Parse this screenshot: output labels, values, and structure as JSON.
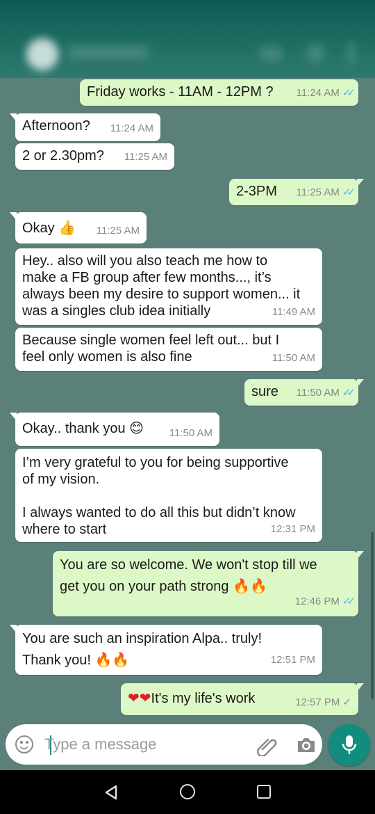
{
  "messages": [
    {
      "id": "m1",
      "dir": "out",
      "text": "Friday works - 11AM - 12PM ?",
      "time": "11:24 AM",
      "status": "read"
    },
    {
      "id": "m2",
      "dir": "in",
      "text": "Afternoon?",
      "time": "11:24 AM"
    },
    {
      "id": "m3",
      "dir": "in",
      "text": "2 or 2.30pm?",
      "time": "11:25 AM"
    },
    {
      "id": "m4",
      "dir": "out",
      "text": "2-3PM",
      "time": "11:25 AM",
      "status": "read"
    },
    {
      "id": "m5",
      "dir": "in",
      "text": "Okay",
      "emoji": "thumbs-up",
      "time": "11:25 AM"
    },
    {
      "id": "m6",
      "dir": "in",
      "lines": [
        "Hey.. also will you also teach me how to",
        "make a FB group after few months..., it’s",
        "always been my desire to support women... it",
        "was a singles club idea initially"
      ],
      "time": "11:49 AM"
    },
    {
      "id": "m7",
      "dir": "in",
      "lines": [
        "Because single women feel left out... but I",
        "feel only women is also fine"
      ],
      "time": "11:50 AM"
    },
    {
      "id": "m8",
      "dir": "out",
      "text": "sure",
      "time": "11:50 AM",
      "status": "read"
    },
    {
      "id": "m9",
      "dir": "in",
      "text": "Okay.. thank you",
      "emoji": "smiling-face",
      "time": "11:50 AM"
    },
    {
      "id": "m10",
      "dir": "in",
      "lines": [
        "I’m very grateful to you for being supportive",
        "of my vision.",
        "",
        "I always wanted to do all this but didn’t know",
        "where to start"
      ],
      "time": "12:31 PM"
    },
    {
      "id": "m11",
      "dir": "out",
      "lines": [
        "You are so welcome. We won't stop till we",
        "get you on your path strong"
      ],
      "emoji": "fire x2",
      "time": "12:46 PM",
      "status": "read"
    },
    {
      "id": "m12",
      "dir": "in",
      "lines": [
        "You are such an inspiration Alpa.. truly!",
        "Thank you!"
      ],
      "emoji": "fire x2",
      "time": "12:51 PM"
    },
    {
      "id": "m13",
      "dir": "out",
      "text": "It's my life's work",
      "emoji": "red-heart x2",
      "time": "12:57 PM",
      "status": "delivered"
    }
  ],
  "input": {
    "placeholder": "Type a message"
  },
  "icons": {
    "emoji": "smiley-icon",
    "attach": "paperclip-icon",
    "camera": "camera-icon",
    "mic": "microphone-icon",
    "nav": [
      "back-triangle-icon",
      "home-circle-icon",
      "recents-square-icon"
    ]
  },
  "colors": {
    "chat_background": "#5b7f79",
    "outgoing_bubble": "#dcf8c6",
    "incoming_bubble": "#ffffff",
    "read_ticks": "#4fb6ec",
    "accent": "#128c7e"
  }
}
